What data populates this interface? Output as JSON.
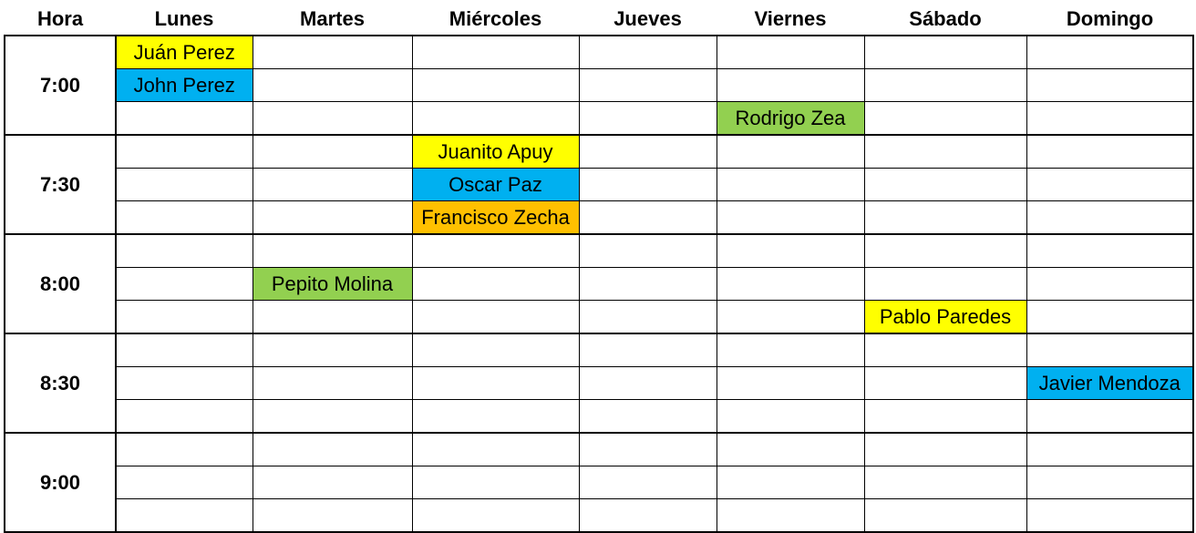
{
  "headers": [
    "Hora",
    "Lunes",
    "Martes",
    "Miércoles",
    "Jueves",
    "Viernes",
    "Sábado",
    "Domingo"
  ],
  "colors": {
    "yellow": "#ffff00",
    "blue": "#00b0f0",
    "green": "#92d050",
    "orange": "#ffc000"
  },
  "hours": [
    "7:00",
    "7:30",
    "8:00",
    "8:30",
    "9:00"
  ],
  "entries": [
    {
      "row": 0,
      "day": 1,
      "name": "Juán Perez",
      "color": "yellow"
    },
    {
      "row": 1,
      "day": 1,
      "name": "John Perez",
      "color": "blue"
    },
    {
      "row": 2,
      "day": 5,
      "name": "Rodrigo Zea",
      "color": "green"
    },
    {
      "row": 3,
      "day": 3,
      "name": "Juanito Apuy",
      "color": "yellow"
    },
    {
      "row": 4,
      "day": 3,
      "name": "Oscar Paz",
      "color": "blue"
    },
    {
      "row": 5,
      "day": 3,
      "name": "Francisco Zecha",
      "color": "orange"
    },
    {
      "row": 7,
      "day": 2,
      "name": "Pepito Molina",
      "color": "green"
    },
    {
      "row": 8,
      "day": 6,
      "name": "Pablo Paredes",
      "color": "yellow"
    },
    {
      "row": 10,
      "day": 7,
      "name": "Javier Mendoza",
      "color": "blue"
    }
  ]
}
